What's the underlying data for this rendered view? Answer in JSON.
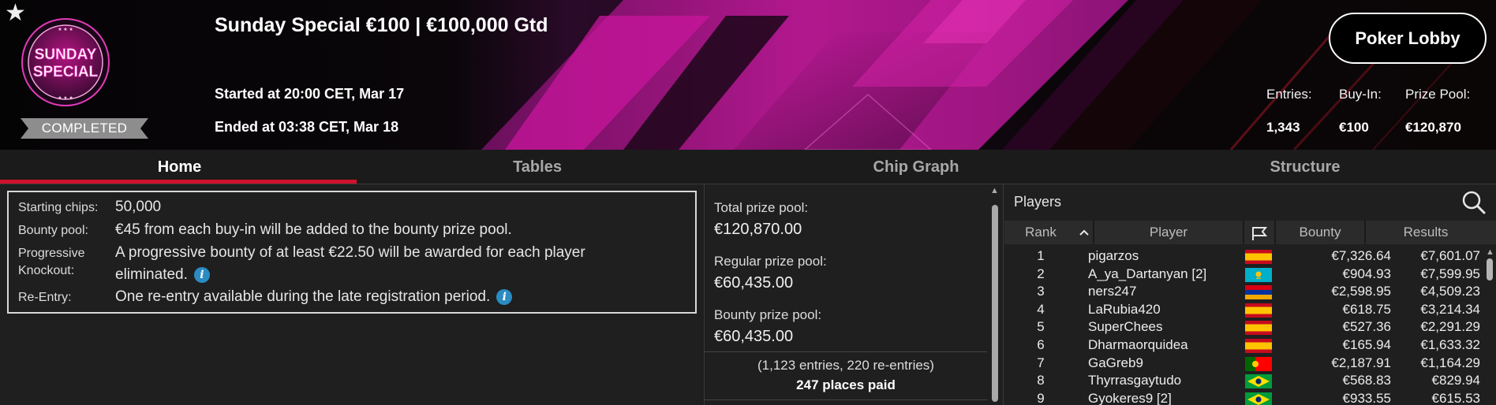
{
  "header": {
    "logo_text": "SUNDAY SPECIAL",
    "status_badge": "COMPLETED",
    "title": "Sunday Special €100 | €100,000 Gtd",
    "started": "Started at 20:00 CET, Mar 17",
    "ended": "Ended at 03:38 CET, Mar 18",
    "lobby_button": "Poker Lobby",
    "stats": [
      {
        "label": "Entries:",
        "value": "1,343"
      },
      {
        "label": "Buy-In:",
        "value": "€100"
      },
      {
        "label": "Prize Pool:",
        "value": "€120,870"
      }
    ],
    "colors": {
      "accent": "#d0112b",
      "magenta": "#c0179b",
      "badge": "#8d8d8d"
    }
  },
  "tabs": [
    {
      "label": "Home",
      "active": true
    },
    {
      "label": "Tables",
      "active": false
    },
    {
      "label": "Chip Graph",
      "active": false
    },
    {
      "label": "Structure",
      "active": false
    }
  ],
  "info": {
    "starting_chips": {
      "label": "Starting chips:",
      "value": "50,000"
    },
    "bounty_pool": {
      "label": "Bounty pool:",
      "value": "€45 from each buy-in will be added to the bounty prize pool."
    },
    "progressive": {
      "label_line1": "Progressive",
      "label_line2": "Knockout:",
      "value_line1": "A progressive bounty of at least €22.50 will be awarded for each player",
      "value_line2": "eliminated."
    },
    "reentry": {
      "label": "Re-Entry:",
      "value": "One re-entry available during the late registration period."
    },
    "info_icon": "info-icon"
  },
  "prize": {
    "total_label": "Total prize pool:",
    "total_value": "€120,870.00",
    "regular_label": "Regular prize pool:",
    "regular_value": "€60,435.00",
    "bounty_label": "Bounty prize pool:",
    "bounty_value": "€60,435.00",
    "entries_text": "(1,123 entries, 220 re-entries)",
    "places_text": "247 places paid"
  },
  "players": {
    "title": "Players",
    "columns": {
      "rank": "Rank",
      "player": "Player",
      "bounty": "Bounty",
      "results": "Results"
    },
    "sort_icon": "chevron-up-icon",
    "flag_column_icon": "flag-icon",
    "rows": [
      {
        "rank": "1",
        "player": "pigarzos",
        "flag": "es",
        "bounty": "€7,326.64",
        "results": "€7,601.07"
      },
      {
        "rank": "2",
        "player": "A_ya_Dartanyan [2]",
        "flag": "kz",
        "bounty": "€904.93",
        "results": "€7,599.95"
      },
      {
        "rank": "3",
        "player": "ners247",
        "flag": "am",
        "bounty": "€2,598.95",
        "results": "€4,509.23"
      },
      {
        "rank": "4",
        "player": "LaRubia420",
        "flag": "es",
        "bounty": "€618.75",
        "results": "€3,214.34"
      },
      {
        "rank": "5",
        "player": "SuperChees",
        "flag": "es",
        "bounty": "€527.36",
        "results": "€2,291.29"
      },
      {
        "rank": "6",
        "player": "Dharmaorquidea",
        "flag": "es",
        "bounty": "€165.94",
        "results": "€1,633.32"
      },
      {
        "rank": "7",
        "player": "GaGreb9",
        "flag": "pt",
        "bounty": "€2,187.91",
        "results": "€1,164.29"
      },
      {
        "rank": "8",
        "player": "Thyrrasgaytudo",
        "flag": "br",
        "bounty": "€568.83",
        "results": "€829.94"
      },
      {
        "rank": "9",
        "player": "Gyokeres9 [2]",
        "flag": "br",
        "bounty": "€933.55",
        "results": "€615.53"
      }
    ]
  }
}
